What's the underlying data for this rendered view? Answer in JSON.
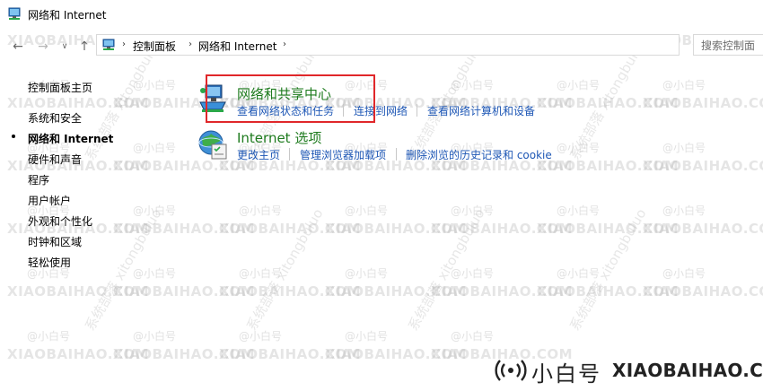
{
  "window": {
    "title": "网络和 Internet"
  },
  "nav": {
    "breadcrumbs": [
      "控制面板",
      "网络和 Internet"
    ],
    "search_placeholder": "搜索控制面"
  },
  "sidebar": {
    "home": "控制面板主页",
    "items": [
      {
        "label": "系统和安全",
        "current": false
      },
      {
        "label": "网络和 Internet",
        "current": true
      },
      {
        "label": "硬件和声音",
        "current": false
      },
      {
        "label": "程序",
        "current": false
      },
      {
        "label": "用户帐户",
        "current": false
      },
      {
        "label": "外观和个性化",
        "current": false
      },
      {
        "label": "时钟和区域",
        "current": false
      },
      {
        "label": "轻松使用",
        "current": false
      }
    ]
  },
  "groups": [
    {
      "title": "网络和共享中心",
      "icon": "network-sharing-icon",
      "tasks": [
        "查看网络状态和任务",
        "连接到网络",
        "查看网络计算机和设备"
      ]
    },
    {
      "title": "Internet 选项",
      "icon": "internet-options-icon",
      "tasks": [
        "更改主页",
        "管理浏览器加载项",
        "删除浏览的历史记录和 cookie"
      ]
    }
  ],
  "watermark": {
    "brand_en": "XIAOBAIHAO.COM",
    "brand_cn": "@小白号",
    "site": "系统部落 xitongbuluo"
  },
  "logo": {
    "cn": "小白号",
    "en": "XIAOBAIHAO.COM"
  },
  "colors": {
    "link": "#1e57b5",
    "group_title": "#1e7b1e",
    "highlight": "#e0272a"
  }
}
